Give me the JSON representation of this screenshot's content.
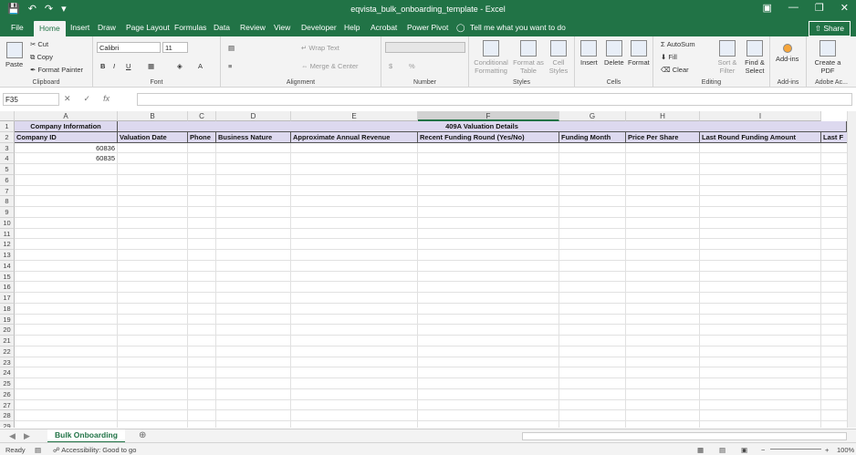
{
  "title_bar": {
    "document_title": "eqvista_bulk_onboarding_template - Excel",
    "qat": [
      "save-icon",
      "undo-icon",
      "redo-icon",
      "customize-icon"
    ]
  },
  "tabs": [
    "File",
    "Home",
    "Insert",
    "Draw",
    "Page Layout",
    "Formulas",
    "Data",
    "Review",
    "View",
    "Developer",
    "Help",
    "Acrobat",
    "Power Pivot"
  ],
  "active_tab": "Home",
  "tell_me": "Tell me what you want to do",
  "share_label": "Share",
  "ribbon": {
    "clipboard": {
      "paste": "Paste",
      "cut": "Cut",
      "copy": "Copy",
      "format_painter": "Format Painter",
      "label": "Clipboard"
    },
    "font": {
      "name": "Calibri",
      "size": "11",
      "bold": "B",
      "italic": "I",
      "underline": "U",
      "label": "Font"
    },
    "alignment": {
      "wrap": "Wrap Text",
      "merge": "Merge & Center",
      "label": "Alignment"
    },
    "number": {
      "format": "",
      "label": "Number"
    },
    "styles": {
      "cond": "Conditional Formatting",
      "table": "Format as Table",
      "cell": "Cell Styles",
      "label": "Styles"
    },
    "cells": {
      "insert": "Insert",
      "delete": "Delete",
      "format": "Format",
      "label": "Cells"
    },
    "editing": {
      "autosum": "AutoSum",
      "fill": "Fill",
      "clear": "Clear",
      "sort": "Sort & Filter",
      "find": "Find & Select",
      "label": "Editing"
    },
    "addins": {
      "label_btn": "Add-ins",
      "label": "Add-ins"
    },
    "adobe": {
      "create": "Create a PDF",
      "label": "Adobe Ac..."
    }
  },
  "formula_bar": {
    "name_box": "F35",
    "fx": "fx",
    "value": ""
  },
  "columns": [
    "A",
    "B",
    "C",
    "D",
    "E",
    "F",
    "G",
    "H",
    "I"
  ],
  "selected_column": "F",
  "row_numbers": [
    "1",
    "2",
    "3",
    "4",
    "5",
    "6",
    "7",
    "8",
    "9",
    "10",
    "11",
    "12",
    "13",
    "14",
    "15",
    "16",
    "17",
    "18",
    "19",
    "20",
    "21",
    "22",
    "23",
    "24",
    "25",
    "26",
    "27",
    "28",
    "29"
  ],
  "sheet": {
    "group_company": "Company Information",
    "group_409a": "409A Valuation Details",
    "headers": [
      "Company ID",
      "Valuation Date",
      "Phone",
      "Business Nature",
      "Approximate Annual Revenue",
      "Recent Funding Round (Yes/No)",
      "Funding Month",
      "Price Per Share",
      "Last Round Funding Amount",
      "Last F"
    ],
    "values": [
      "60836",
      "60835"
    ]
  },
  "sheet_tab": "Bulk Onboarding",
  "status": {
    "ready": "Ready",
    "accessibility": "Accessibility: Good to go",
    "zoom": "100%"
  }
}
